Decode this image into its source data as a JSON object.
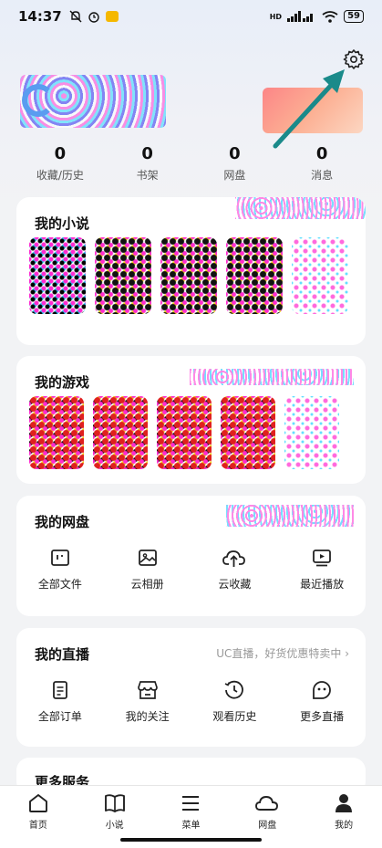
{
  "status_bar": {
    "time": "14:37",
    "battery": "59",
    "network_label": "HD"
  },
  "stats": [
    {
      "value": "0",
      "label": "收藏/历史"
    },
    {
      "value": "0",
      "label": "书架"
    },
    {
      "value": "0",
      "label": "网盘"
    },
    {
      "value": "0",
      "label": "消息"
    }
  ],
  "cards": {
    "novel": {
      "title": "我的小说"
    },
    "game": {
      "title": "我的游戏"
    },
    "netdisk": {
      "title": "我的网盘",
      "items": [
        {
          "label": "全部文件",
          "icon": "folder-icon"
        },
        {
          "label": "云相册",
          "icon": "photo-icon"
        },
        {
          "label": "云收藏",
          "icon": "cloud-upload-icon"
        },
        {
          "label": "最近播放",
          "icon": "play-icon"
        }
      ]
    },
    "live": {
      "title": "我的直播",
      "subtitle": "UC直播，好货优惠特卖中 ›",
      "items": [
        {
          "label": "全部订单",
          "icon": "order-icon"
        },
        {
          "label": "我的关注",
          "icon": "store-icon"
        },
        {
          "label": "观看历史",
          "icon": "history-icon"
        },
        {
          "label": "更多直播",
          "icon": "live-icon"
        }
      ]
    },
    "more": {
      "title": "更多服务"
    }
  },
  "bottom_nav": [
    {
      "label": "首页",
      "icon": "home-icon"
    },
    {
      "label": "小说",
      "icon": "book-icon"
    },
    {
      "label": "菜单",
      "icon": "menu-icon"
    },
    {
      "label": "网盘",
      "icon": "cloud-icon"
    },
    {
      "label": "我的",
      "icon": "user-icon"
    }
  ],
  "colors": {
    "accent_arrow": "#1a8a8a",
    "background": "#f2f3f5",
    "card": "#ffffff"
  }
}
